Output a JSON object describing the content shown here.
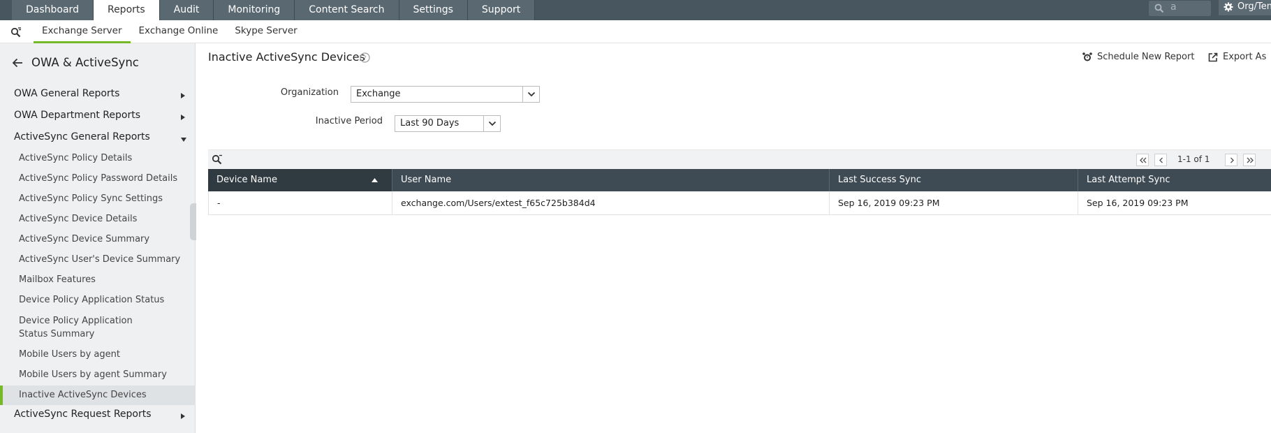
{
  "topnav": {
    "tabs": [
      "Dashboard",
      "Reports",
      "Audit",
      "Monitoring",
      "Content Search",
      "Settings",
      "Support"
    ],
    "active_tab": "Reports",
    "search_value": "a",
    "org_label": "Org/Ten"
  },
  "subnav": {
    "items": [
      "Exchange Server",
      "Exchange Online",
      "Skype Server"
    ],
    "active": "Exchange Server"
  },
  "sidebar": {
    "title": "OWA & ActiveSync",
    "categories": [
      "OWA General Reports",
      "OWA Department Reports",
      "ActiveSync General Reports",
      "ActiveSync Request Reports"
    ],
    "items": [
      "ActiveSync Policy Details",
      "ActiveSync Policy Password Details",
      "ActiveSync Policy Sync Settings",
      "ActiveSync Device Details",
      "ActiveSync Device Summary",
      "ActiveSync User's Device Summary",
      "Mailbox Features",
      "Device Policy Application Status",
      "Device Policy Application Status Summary",
      "Mobile Users by agent",
      "Mobile Users by agent Summary",
      "Inactive ActiveSync Devices"
    ],
    "selected_item": "Inactive ActiveSync Devices"
  },
  "page": {
    "title": "Inactive ActiveSync Devices",
    "schedule_label": "Schedule New Report",
    "export_label": "Export As"
  },
  "filters": {
    "organization_label": "Organization",
    "organization_value": "Exchange",
    "period_label": "Inactive Period",
    "period_value": "Last 90 Days"
  },
  "pagination": {
    "info": "1-1 of 1"
  },
  "table": {
    "columns": [
      "Device Name",
      "User Name",
      "Last Success Sync",
      "Last Attempt Sync"
    ],
    "sorted_column": "Device Name",
    "rows": [
      [
        "-",
        "exchange.com/Users/extest_f65c725b384d4",
        "Sep 16, 2019 09:23 PM",
        "Sep 16, 2019 09:23 PM"
      ]
    ]
  },
  "colors": {
    "accent": "#76b82a",
    "nav_bg": "#485660",
    "table_header": "#3e4b54"
  }
}
